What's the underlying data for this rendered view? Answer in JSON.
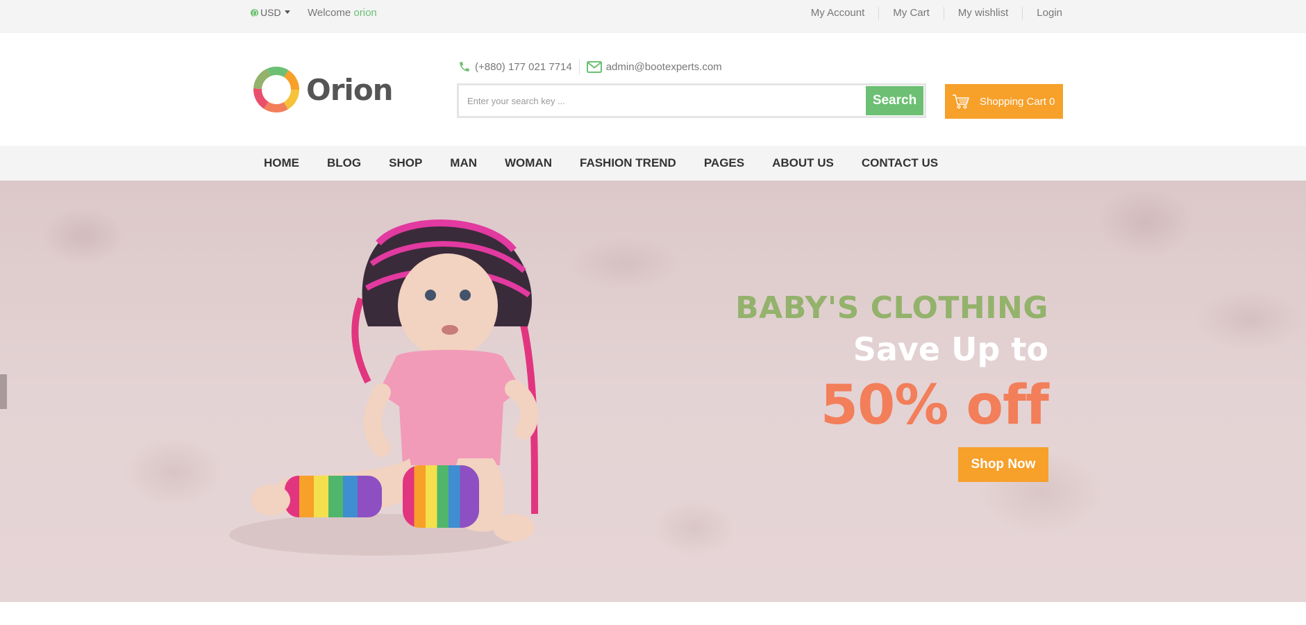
{
  "topbar": {
    "currency": "USD",
    "welcome_prefix": "Welcome",
    "welcome_user": "orion",
    "links": [
      "My Account",
      "My Cart",
      "My wishlist",
      "Login"
    ]
  },
  "header": {
    "logo_text": "Orion",
    "phone": "(+880) 177 021 7714",
    "email": "admin@bootexperts.com",
    "search_placeholder": "Enter your search key ...",
    "search_button": "Search",
    "cart_label": "Shopping Cart 0"
  },
  "nav": {
    "items": [
      "HOME",
      "BLOG",
      "SHOP",
      "MAN",
      "WOMAN",
      "FASHION TREND",
      "PAGES",
      "ABOUT US",
      "CONTACT US"
    ]
  },
  "hero": {
    "kicker": "BABY'S CLOTHING",
    "headline": "Save Up to",
    "discount": "50% off",
    "cta": "Shop Now"
  },
  "colors": {
    "accent_green": "#6cbf73",
    "accent_orange": "#f7a02a",
    "hero_green": "#93b26b",
    "hero_coral": "#f27e5a"
  },
  "icons": [
    "globe-icon",
    "caret-down-icon",
    "phone-icon",
    "mail-icon",
    "cart-icon",
    "logo-ring-icon"
  ]
}
